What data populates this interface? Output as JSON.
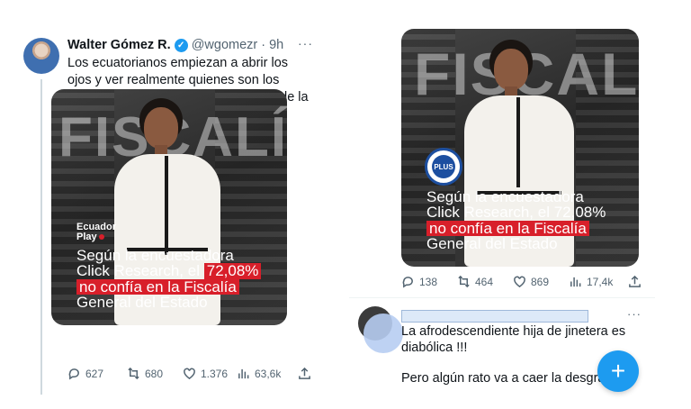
{
  "left_tweet": {
    "display_name": "Walter Gómez R.",
    "handle": "@wgomezr",
    "separator": "·",
    "time": "9h",
    "more": "···",
    "text": "Los ecuatorianos empiezan a abrir los ojos y ver realmente quienes son los corruptos, cómplices y encubridores de la debacle nacional.",
    "media": {
      "bg_word": "FISCALÍA",
      "logo_line1": "Ecuador",
      "logo_line2": "Play",
      "caption_1": "Según la encuestadora",
      "caption_2": "Click Research, el",
      "caption_2_hl": "72,08%",
      "caption_3": "no confía en la Fiscalía",
      "caption_4": "General del Estado"
    },
    "stats": {
      "replies": "627",
      "retweets": "680",
      "likes": "1.376",
      "views": "63,6k"
    }
  },
  "right_tweet": {
    "media": {
      "bg_word": "FISCALÍA",
      "badge": "PLUS",
      "caption_1": "Según la encuestadora",
      "caption_2": "Click Research, el 72,08%",
      "caption_3": "no confía en la Fiscalía",
      "caption_4": "General del Estado"
    },
    "stats": {
      "replies": "138",
      "retweets": "464",
      "likes": "869",
      "views": "17,4k"
    }
  },
  "reply": {
    "more": "···",
    "text_1": "La afrodescendiente hija de jinetera es diabólica !!!",
    "text_2": "Pero algún rato va a caer la desgracia"
  },
  "fab": {
    "label": "+"
  },
  "colors": {
    "accent": "#1d9bf0",
    "highlight": "#d81f2a",
    "muted": "#536471"
  }
}
